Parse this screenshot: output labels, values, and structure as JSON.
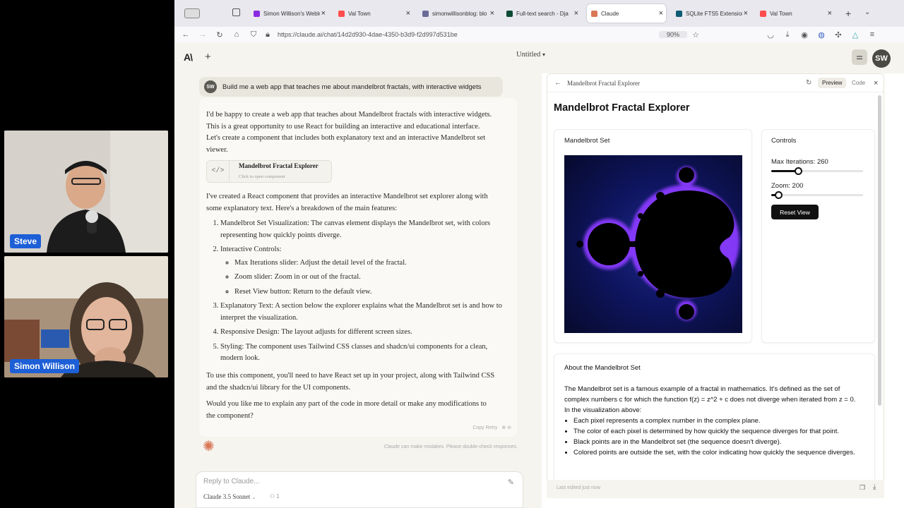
{
  "video": {
    "participants": [
      {
        "name": "Steve"
      },
      {
        "name": "Simon Willison"
      }
    ]
  },
  "browser": {
    "tabs": [
      {
        "label": "Simon Willison's Weblog",
        "color": "#8a2be2"
      },
      {
        "label": "Val Town",
        "color": "#ff4d4d"
      },
      {
        "label": "simonwillisonblog: blo",
        "color": "#6b6b9a"
      },
      {
        "label": "Full-text search - Dja",
        "color": "#0c4b33"
      },
      {
        "label": "Claude",
        "color": "#d97757"
      },
      {
        "label": "SQLite FTS5 Extension",
        "color": "#0f5c75"
      },
      {
        "label": "Val Town",
        "color": "#ff4d4d"
      }
    ],
    "url": "https://claude.ai/chat/14d2d930-4dae-4350-b3d9-f2d997d531be",
    "zoom": "90%"
  },
  "app": {
    "title": "Untitled",
    "user_initials": "SW"
  },
  "chat": {
    "user_initials": "SW",
    "user_message": "Build me a web app that teaches me about mandelbrot fractals, with interactive widgets",
    "intro": "I'd be happy to create a web app that teaches about Mandelbrot fractals with interactive widgets. This is a great opportunity to use React for building an interactive and educational interface. Let's create a component that includes both explanatory text and an interactive Mandelbrot set viewer.",
    "artifact": {
      "title": "Mandelbrot Fractal Explorer",
      "subtitle": "Click to open component"
    },
    "summary": "I've created a React component that provides an interactive Mandelbrot set explorer along with some explanatory text. Here's a breakdown of the main features:",
    "features": [
      "Mandelbrot Set Visualization: The canvas element displays the Mandelbrot set, with colors representing how quickly points diverge.",
      "Interactive Controls:",
      "Explanatory Text: A section below the explorer explains what the Mandelbrot set is and how to interpret the visualization.",
      "Responsive Design: The layout adjusts for different screen sizes.",
      "Styling: The component uses Tailwind CSS classes and shadcn/ui components for a clean, modern look."
    ],
    "controls_sub": [
      "Max Iterations slider: Adjust the detail level of the fractal.",
      "Zoom slider: Zoom in or out of the fractal.",
      "Reset View button: Return to the default view."
    ],
    "usage": "To use this component, you'll need to have React set up in your project, along with Tailwind CSS and the shadcn/ui library for the UI components.",
    "followup": "Would you like me to explain any part of the code in more detail or make any modifications to the component?",
    "actions": "Copy   Retry",
    "disclaimer": "Claude can make mistakes. Please double-check responses.",
    "composer_placeholder": "Reply to Claude...",
    "model": "Claude 3.5 Sonnet"
  },
  "artifact_panel": {
    "header_title": "Mandelbrot Fractal Explorer",
    "tab_preview": "Preview",
    "tab_code": "Code",
    "heading": "Mandelbrot Fractal Explorer",
    "set_label": "Mandelbrot Set",
    "controls_label": "Controls",
    "max_iter_label": "Max Iterations: 260",
    "max_iter_fraction": 0.29,
    "zoom_label": "Zoom: 200",
    "zoom_fraction": 0.08,
    "reset_label": "Reset View",
    "about_title": "About the Mandelbrot Set",
    "about_text": "The Mandelbrot set is a famous example of a fractal in mathematics. It's defined as the set of complex numbers c for which the function f(z) = z^2 + c does not diverge when iterated from z = 0.",
    "about_intro": "In the visualization above:",
    "about_points": [
      "Each pixel represents a complex number in the complex plane.",
      "The color of each pixel is determined by how quickly the sequence diverges for that point.",
      "Black points are in the Mandelbrot set (the sequence doesn't diverge).",
      "Colored points are outside the set, with the color indicating how quickly the sequence diverges."
    ],
    "footer": "Last edited just now"
  }
}
